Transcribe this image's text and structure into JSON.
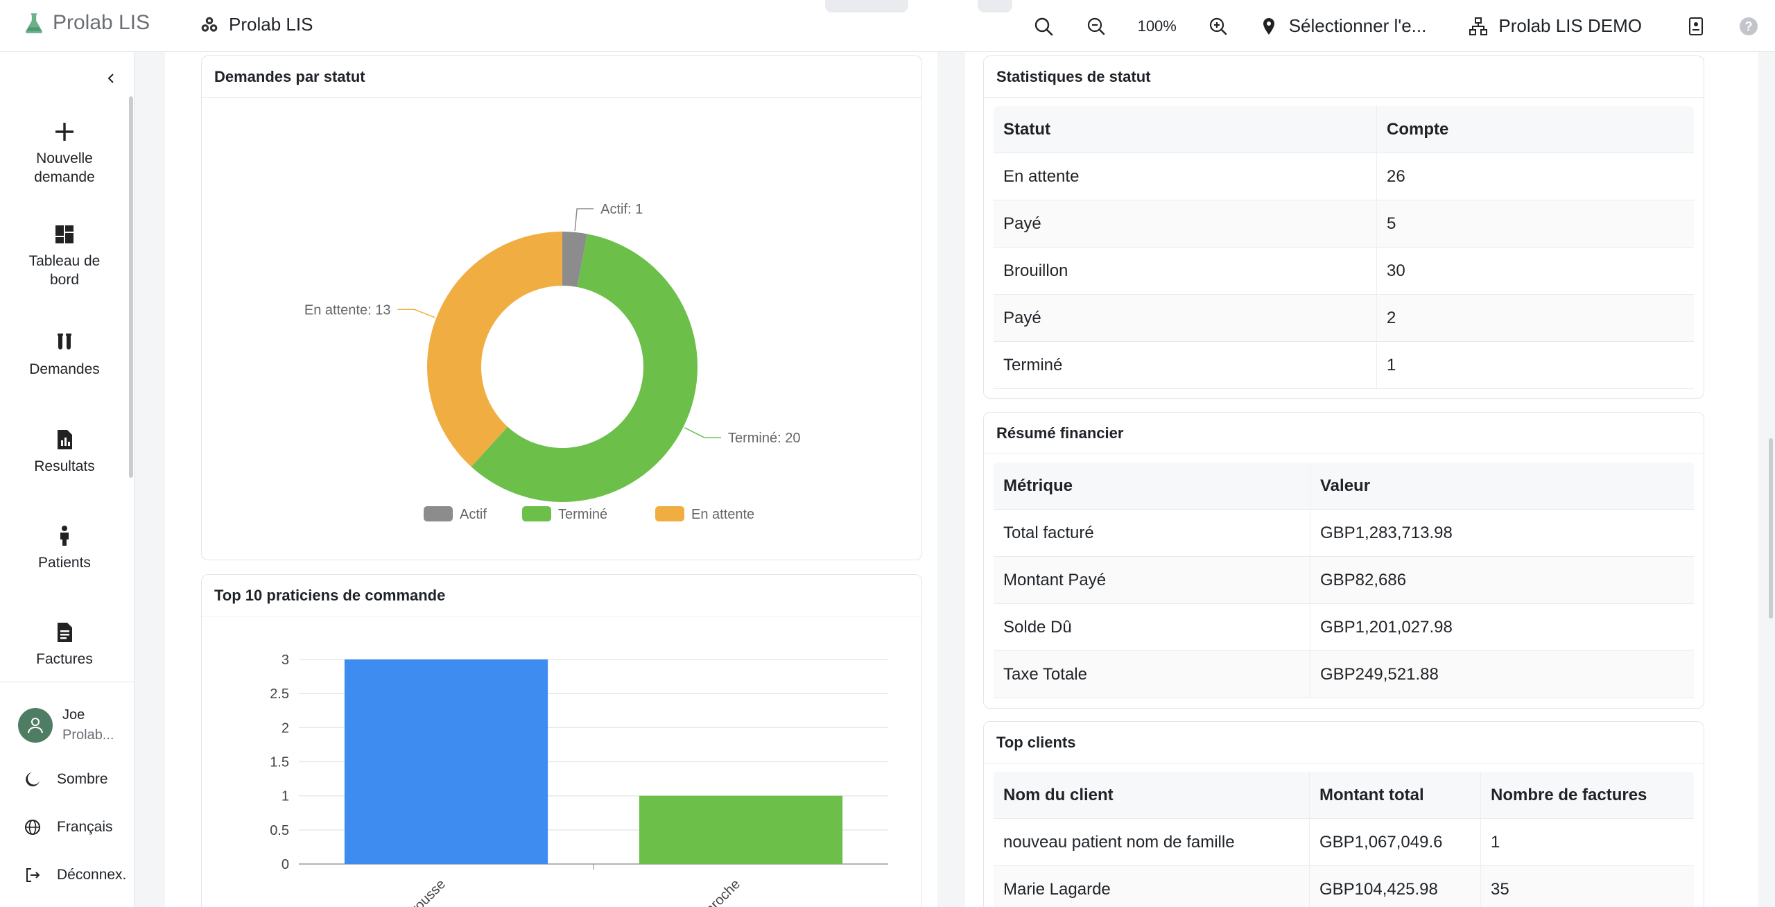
{
  "brand": {
    "name": "Prolab LIS"
  },
  "header": {
    "app_title": "Prolab LIS",
    "zoom": "100%",
    "location": "Sélectionner l'e...",
    "organization": "Prolab LIS DEMO"
  },
  "sidebar": {
    "items": [
      {
        "label": "Nouvelle demande",
        "icon": "plus-icon"
      },
      {
        "label": "Tableau de bord",
        "icon": "dashboard-icon"
      },
      {
        "label": "Demandes",
        "icon": "test-tubes-icon"
      },
      {
        "label": "Resultats",
        "icon": "report-icon"
      },
      {
        "label": "Patients",
        "icon": "person-icon"
      },
      {
        "label": "Factures",
        "icon": "invoice-icon"
      }
    ],
    "user": {
      "name": "Joe",
      "org": "Prolab..."
    },
    "theme": "Sombre",
    "language": "Français",
    "logout": "Déconnex."
  },
  "status_chart_card": {
    "title": "Demandes par statut"
  },
  "practitioners_card": {
    "title": "Top 10 praticiens de commande"
  },
  "status_stats": {
    "title": "Statistiques de statut",
    "columns": [
      "Statut",
      "Compte"
    ],
    "rows": [
      [
        "En attente",
        "26"
      ],
      [
        "Payé",
        "5"
      ],
      [
        "Brouillon",
        "30"
      ],
      [
        "Payé",
        "2"
      ],
      [
        "Terminé",
        "1"
      ]
    ]
  },
  "financial": {
    "title": "Résumé financier",
    "columns": [
      "Métrique",
      "Valeur"
    ],
    "rows": [
      [
        "Total facturé",
        "GBP1,283,713.98"
      ],
      [
        "Montant Payé",
        "GBP82,686"
      ],
      [
        "Solde Dû",
        "GBP1,201,027.98"
      ],
      [
        "Taxe Totale",
        "GBP249,521.88"
      ]
    ]
  },
  "top_clients": {
    "title": "Top clients",
    "columns": [
      "Nom du client",
      "Montant total",
      "Nombre de factures"
    ],
    "rows": [
      [
        "nouveau patient nom de famille",
        "GBP1,067,049.6",
        "1"
      ],
      [
        "Marie Lagarde",
        "GBP104,425.98",
        "35"
      ]
    ]
  },
  "colors": {
    "actif": "#8c8c8c",
    "termine": "#6cc04a",
    "en_attente": "#f0ae42",
    "bar_blue": "#3f8cf0",
    "bar_green": "#6cc04a"
  },
  "chart_data": [
    {
      "type": "pie",
      "title": "Demandes par statut",
      "categories": [
        "Actif",
        "Terminé",
        "En attente"
      ],
      "values": [
        1,
        20,
        13
      ],
      "data_labels": [
        "Actif: 1",
        "Terminé: 20",
        "En attente: 13"
      ],
      "legend": "bottom",
      "donut": true
    },
    {
      "type": "bar",
      "title": "Top 10 praticiens de commande",
      "categories": [
        "Dr Larousse",
        "Dr Laroche"
      ],
      "values": [
        3,
        1
      ],
      "ylim": [
        0,
        3
      ],
      "yticks": [
        "0",
        "0.5",
        "1",
        "1.5",
        "2",
        "2.5",
        "3"
      ],
      "grid": true
    }
  ]
}
